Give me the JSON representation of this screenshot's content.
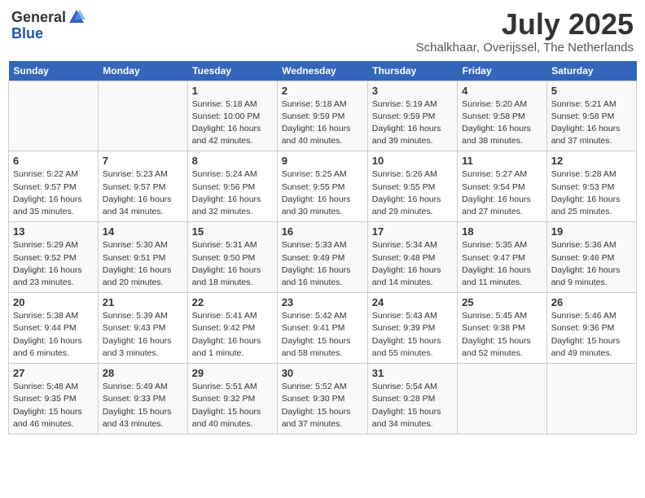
{
  "header": {
    "logo_general": "General",
    "logo_blue": "Blue",
    "month": "July 2025",
    "location": "Schalkhaar, Overijssel, The Netherlands"
  },
  "weekdays": [
    "Sunday",
    "Monday",
    "Tuesday",
    "Wednesday",
    "Thursday",
    "Friday",
    "Saturday"
  ],
  "weeks": [
    [
      {
        "day": "",
        "info": ""
      },
      {
        "day": "",
        "info": ""
      },
      {
        "day": "1",
        "info": "Sunrise: 5:18 AM\nSunset: 10:00 PM\nDaylight: 16 hours\nand 42 minutes."
      },
      {
        "day": "2",
        "info": "Sunrise: 5:18 AM\nSunset: 9:59 PM\nDaylight: 16 hours\nand 40 minutes."
      },
      {
        "day": "3",
        "info": "Sunrise: 5:19 AM\nSunset: 9:59 PM\nDaylight: 16 hours\nand 39 minutes."
      },
      {
        "day": "4",
        "info": "Sunrise: 5:20 AM\nSunset: 9:58 PM\nDaylight: 16 hours\nand 38 minutes."
      },
      {
        "day": "5",
        "info": "Sunrise: 5:21 AM\nSunset: 9:58 PM\nDaylight: 16 hours\nand 37 minutes."
      }
    ],
    [
      {
        "day": "6",
        "info": "Sunrise: 5:22 AM\nSunset: 9:57 PM\nDaylight: 16 hours\nand 35 minutes."
      },
      {
        "day": "7",
        "info": "Sunrise: 5:23 AM\nSunset: 9:57 PM\nDaylight: 16 hours\nand 34 minutes."
      },
      {
        "day": "8",
        "info": "Sunrise: 5:24 AM\nSunset: 9:56 PM\nDaylight: 16 hours\nand 32 minutes."
      },
      {
        "day": "9",
        "info": "Sunrise: 5:25 AM\nSunset: 9:55 PM\nDaylight: 16 hours\nand 30 minutes."
      },
      {
        "day": "10",
        "info": "Sunrise: 5:26 AM\nSunset: 9:55 PM\nDaylight: 16 hours\nand 29 minutes."
      },
      {
        "day": "11",
        "info": "Sunrise: 5:27 AM\nSunset: 9:54 PM\nDaylight: 16 hours\nand 27 minutes."
      },
      {
        "day": "12",
        "info": "Sunrise: 5:28 AM\nSunset: 9:53 PM\nDaylight: 16 hours\nand 25 minutes."
      }
    ],
    [
      {
        "day": "13",
        "info": "Sunrise: 5:29 AM\nSunset: 9:52 PM\nDaylight: 16 hours\nand 23 minutes."
      },
      {
        "day": "14",
        "info": "Sunrise: 5:30 AM\nSunset: 9:51 PM\nDaylight: 16 hours\nand 20 minutes."
      },
      {
        "day": "15",
        "info": "Sunrise: 5:31 AM\nSunset: 9:50 PM\nDaylight: 16 hours\nand 18 minutes."
      },
      {
        "day": "16",
        "info": "Sunrise: 5:33 AM\nSunset: 9:49 PM\nDaylight: 16 hours\nand 16 minutes."
      },
      {
        "day": "17",
        "info": "Sunrise: 5:34 AM\nSunset: 9:48 PM\nDaylight: 16 hours\nand 14 minutes."
      },
      {
        "day": "18",
        "info": "Sunrise: 5:35 AM\nSunset: 9:47 PM\nDaylight: 16 hours\nand 11 minutes."
      },
      {
        "day": "19",
        "info": "Sunrise: 5:36 AM\nSunset: 9:46 PM\nDaylight: 16 hours\nand 9 minutes."
      }
    ],
    [
      {
        "day": "20",
        "info": "Sunrise: 5:38 AM\nSunset: 9:44 PM\nDaylight: 16 hours\nand 6 minutes."
      },
      {
        "day": "21",
        "info": "Sunrise: 5:39 AM\nSunset: 9:43 PM\nDaylight: 16 hours\nand 3 minutes."
      },
      {
        "day": "22",
        "info": "Sunrise: 5:41 AM\nSunset: 9:42 PM\nDaylight: 16 hours\nand 1 minute."
      },
      {
        "day": "23",
        "info": "Sunrise: 5:42 AM\nSunset: 9:41 PM\nDaylight: 15 hours\nand 58 minutes."
      },
      {
        "day": "24",
        "info": "Sunrise: 5:43 AM\nSunset: 9:39 PM\nDaylight: 15 hours\nand 55 minutes."
      },
      {
        "day": "25",
        "info": "Sunrise: 5:45 AM\nSunset: 9:38 PM\nDaylight: 15 hours\nand 52 minutes."
      },
      {
        "day": "26",
        "info": "Sunrise: 5:46 AM\nSunset: 9:36 PM\nDaylight: 15 hours\nand 49 minutes."
      }
    ],
    [
      {
        "day": "27",
        "info": "Sunrise: 5:48 AM\nSunset: 9:35 PM\nDaylight: 15 hours\nand 46 minutes."
      },
      {
        "day": "28",
        "info": "Sunrise: 5:49 AM\nSunset: 9:33 PM\nDaylight: 15 hours\nand 43 minutes."
      },
      {
        "day": "29",
        "info": "Sunrise: 5:51 AM\nSunset: 9:32 PM\nDaylight: 15 hours\nand 40 minutes."
      },
      {
        "day": "30",
        "info": "Sunrise: 5:52 AM\nSunset: 9:30 PM\nDaylight: 15 hours\nand 37 minutes."
      },
      {
        "day": "31",
        "info": "Sunrise: 5:54 AM\nSunset: 9:28 PM\nDaylight: 15 hours\nand 34 minutes."
      },
      {
        "day": "",
        "info": ""
      },
      {
        "day": "",
        "info": ""
      }
    ]
  ]
}
